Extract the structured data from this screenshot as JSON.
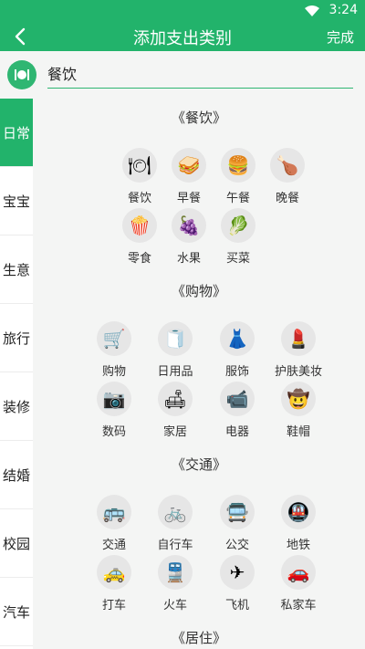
{
  "status": {
    "time": "3:24"
  },
  "header": {
    "title": "添加支出类别",
    "done_label": "完成"
  },
  "input": {
    "value": "餐饮"
  },
  "sidebar": {
    "items": [
      "日常",
      "宝宝",
      "生意",
      "旅行",
      "装修",
      "结婚",
      "校园",
      "汽车"
    ],
    "active": "日常"
  },
  "sections": [
    {
      "title": "《餐饮》",
      "items": [
        {
          "label": "餐饮",
          "icon": "🍽"
        },
        {
          "label": "早餐",
          "icon": "🥪"
        },
        {
          "label": "午餐",
          "icon": "🍔"
        },
        {
          "label": "晚餐",
          "icon": "🍗"
        },
        {
          "label": "零食",
          "icon": "🍿"
        },
        {
          "label": "水果",
          "icon": "🍇"
        },
        {
          "label": "买菜",
          "icon": "🥬"
        }
      ]
    },
    {
      "title": "《购物》",
      "items": [
        {
          "label": "购物",
          "icon": "🛒"
        },
        {
          "label": "日用品",
          "icon": "🧻"
        },
        {
          "label": "服饰",
          "icon": "👗"
        },
        {
          "label": "护肤美妆",
          "icon": "💄"
        },
        {
          "label": "数码",
          "icon": "📷"
        },
        {
          "label": "家居",
          "icon": "🛋"
        },
        {
          "label": "电器",
          "icon": "📹"
        },
        {
          "label": "鞋帽",
          "icon": "🤠"
        }
      ]
    },
    {
      "title": "《交通》",
      "items": [
        {
          "label": "交通",
          "icon": "🚌"
        },
        {
          "label": "自行车",
          "icon": "🚲"
        },
        {
          "label": "公交",
          "icon": "🚍"
        },
        {
          "label": "地铁",
          "icon": "🚇"
        },
        {
          "label": "打车",
          "icon": "🚕"
        },
        {
          "label": "火车",
          "icon": "🚆"
        },
        {
          "label": "飞机",
          "icon": "✈"
        },
        {
          "label": "私家车",
          "icon": "🚗"
        }
      ]
    },
    {
      "title": "《居住》",
      "items": []
    }
  ]
}
